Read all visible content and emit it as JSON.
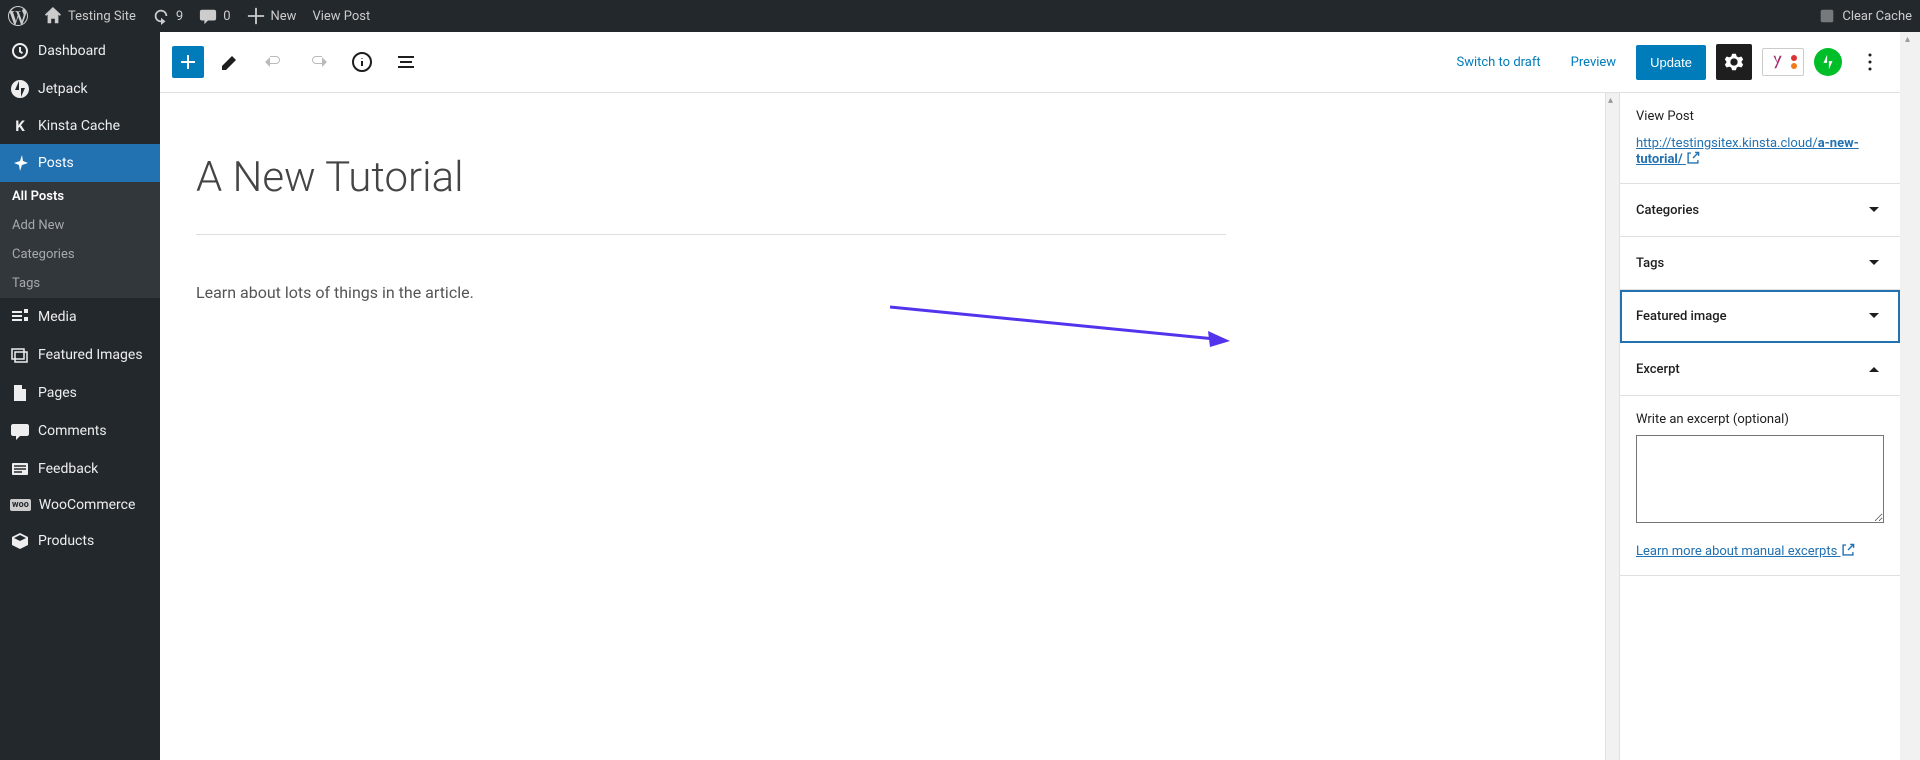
{
  "adminbar": {
    "site_name": "Testing Site",
    "updates_count": "9",
    "comments_count": "0",
    "new_label": "New",
    "view_post_label": "View Post",
    "clear_cache_label": "Clear Cache"
  },
  "sidebar": {
    "items": [
      {
        "label": "Dashboard",
        "icon": "dashboard"
      },
      {
        "label": "Jetpack",
        "icon": "jetpack"
      },
      {
        "label": "Kinsta Cache",
        "icon": "kinsta"
      },
      {
        "label": "Posts",
        "icon": "pin",
        "active": true
      },
      {
        "label": "Media",
        "icon": "media"
      },
      {
        "label": "Featured Images",
        "icon": "images"
      },
      {
        "label": "Pages",
        "icon": "pages"
      },
      {
        "label": "Comments",
        "icon": "comments"
      },
      {
        "label": "Feedback",
        "icon": "feedback"
      },
      {
        "label": "WooCommerce",
        "icon": "woo"
      },
      {
        "label": "Products",
        "icon": "products"
      }
    ],
    "posts_sub": [
      {
        "label": "All Posts",
        "current": true
      },
      {
        "label": "Add New"
      },
      {
        "label": "Categories"
      },
      {
        "label": "Tags"
      }
    ]
  },
  "header": {
    "switch_draft": "Switch to draft",
    "preview": "Preview",
    "update": "Update"
  },
  "post": {
    "title": "A New Tutorial",
    "content": "Learn about lots of things in the article."
  },
  "settings": {
    "view_post_heading": "View Post",
    "permalink_base": "http://testingsitex.kinsta.cloud/",
    "permalink_slug": "a-new-tutorial/",
    "categories_label": "Categories",
    "tags_label": "Tags",
    "featured_image_label": "Featured image",
    "excerpt_label": "Excerpt",
    "excerpt_field_label": "Write an excerpt (optional)",
    "excerpt_learn_more": "Learn more about manual excerpts"
  }
}
